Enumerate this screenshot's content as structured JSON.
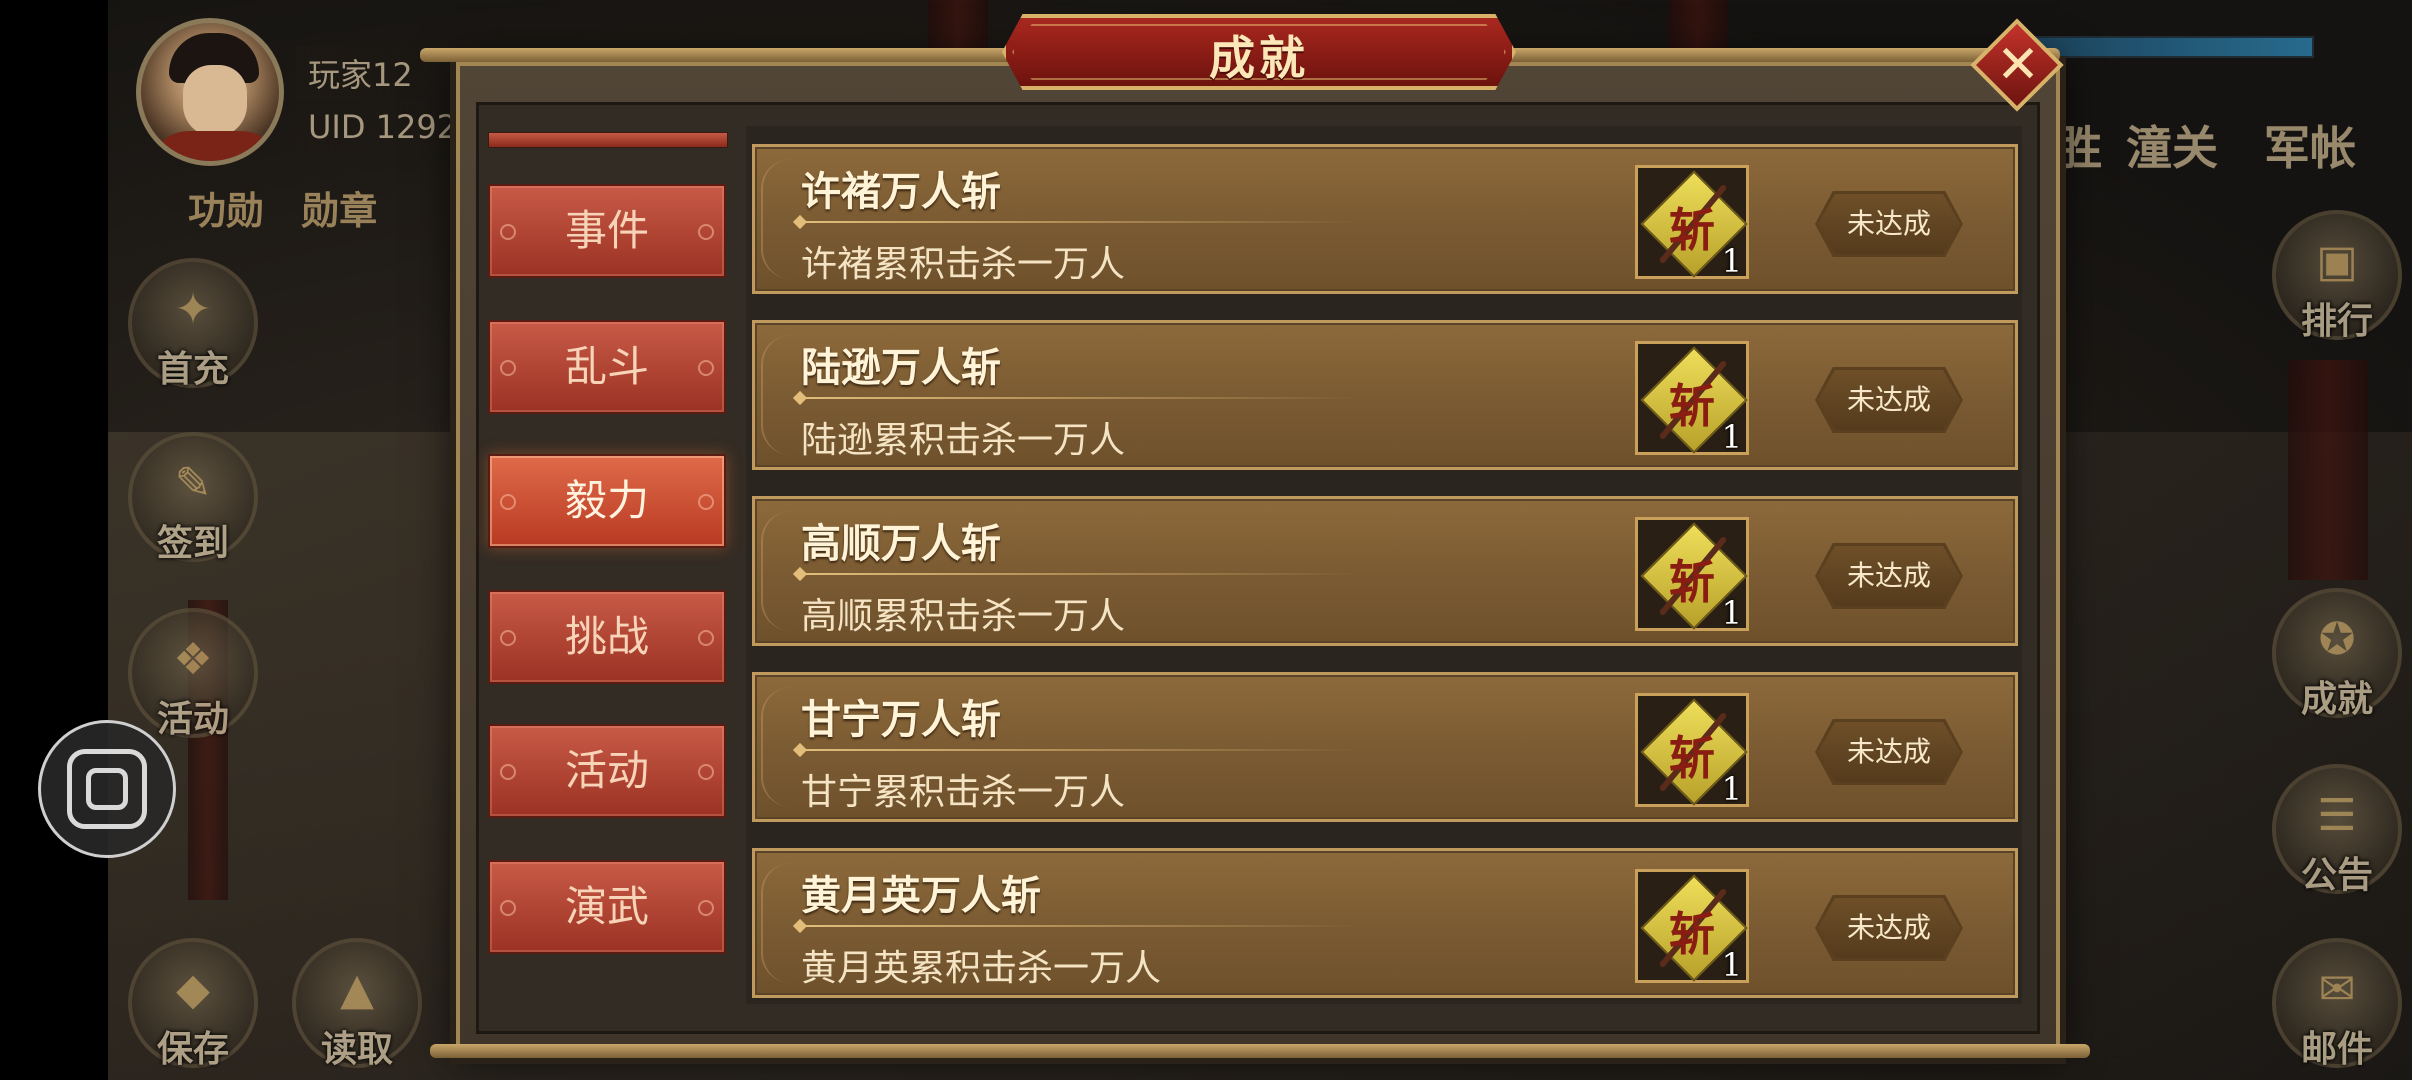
{
  "player": {
    "name": "玩家12",
    "uid_label": "UID",
    "uid_value": "1292"
  },
  "left_header": [
    "功勋",
    "勋章"
  ],
  "left_side_buttons": [
    {
      "label": "首充",
      "icon": "gift-bag-icon"
    },
    {
      "label": "签到",
      "icon": "scroll-brush-icon"
    },
    {
      "label": "活动",
      "icon": "treasure-icon"
    },
    {
      "label": "保存",
      "icon": "save-icon"
    },
    {
      "label": "读取",
      "icon": "load-icon"
    }
  ],
  "right_tabs": [
    "胜",
    "潼关",
    "军帐"
  ],
  "right_side_buttons": [
    {
      "label": "排行",
      "icon": "ranking-plaque-icon"
    },
    {
      "label": "成就",
      "icon": "achievement-icon"
    },
    {
      "label": "公告",
      "icon": "announcement-scroll-icon"
    },
    {
      "label": "邮件",
      "icon": "mail-icon"
    }
  ],
  "modal": {
    "title": "成就",
    "close_icon": "close-x-icon",
    "tabs": [
      {
        "label": "事件",
        "active": false
      },
      {
        "label": "乱斗",
        "active": false
      },
      {
        "label": "毅力",
        "active": true
      },
      {
        "label": "挑战",
        "active": false
      },
      {
        "label": "活动",
        "active": false
      },
      {
        "label": "演武",
        "active": false
      }
    ],
    "achievements": [
      {
        "title": "许褚万人斩",
        "desc": "许褚累积击杀一万人",
        "reward_glyph": "斩",
        "reward_qty": "1",
        "status": "未达成"
      },
      {
        "title": "陆逊万人斩",
        "desc": "陆逊累积击杀一万人",
        "reward_glyph": "斩",
        "reward_qty": "1",
        "status": "未达成"
      },
      {
        "title": "高顺万人斩",
        "desc": "高顺累积击杀一万人",
        "reward_glyph": "斩",
        "reward_qty": "1",
        "status": "未达成"
      },
      {
        "title": "甘宁万人斩",
        "desc": "甘宁累积击杀一万人",
        "reward_glyph": "斩",
        "reward_qty": "1",
        "status": "未达成"
      },
      {
        "title": "黄月英万人斩",
        "desc": "黄月英累积击杀一万人",
        "reward_glyph": "斩",
        "reward_qty": "1",
        "status": "未达成"
      }
    ]
  },
  "colors": {
    "title_red": "#a9281f",
    "tab_red": "#c85a47",
    "row_brown": "#8d6a3b",
    "gold_border": "#c0995c"
  }
}
